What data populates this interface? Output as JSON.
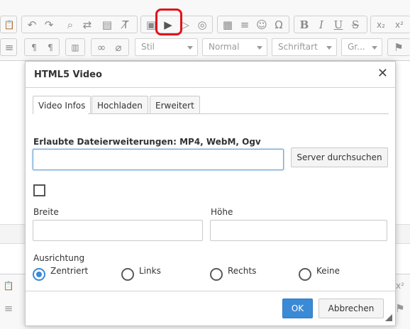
{
  "toolbar": {
    "row1": [
      {
        "icon": "undo-icon",
        "glyph": "↶"
      },
      {
        "icon": "redo-icon",
        "glyph": "↷"
      },
      {
        "icon": "find-icon",
        "glyph": "⌕"
      },
      {
        "icon": "replace-icon",
        "glyph": "⇄"
      },
      {
        "icon": "select-all-icon",
        "glyph": "▤"
      },
      {
        "icon": "remove-format-icon",
        "glyph": "T̸"
      },
      {
        "icon": "image-icon",
        "glyph": "▣"
      },
      {
        "icon": "html5-video-icon",
        "glyph": "▶"
      },
      {
        "icon": "audio-icon",
        "glyph": "▷"
      },
      {
        "icon": "flash-icon",
        "glyph": "◎"
      },
      {
        "icon": "table-icon",
        "glyph": "▦"
      },
      {
        "icon": "horizontal-line-icon",
        "glyph": "≡"
      },
      {
        "icon": "smiley-icon",
        "glyph": "☺"
      },
      {
        "icon": "special-char-icon",
        "glyph": "Ω"
      },
      {
        "icon": "bold-icon",
        "glyph": "B"
      },
      {
        "icon": "italic-icon",
        "glyph": "I"
      },
      {
        "icon": "underline-icon",
        "glyph": "U"
      },
      {
        "icon": "strike-icon",
        "glyph": "S"
      },
      {
        "icon": "subscript-icon",
        "glyph": "x₂"
      },
      {
        "icon": "superscript-icon",
        "glyph": "x²"
      }
    ],
    "combos": {
      "style": "Stil",
      "format": "Normal",
      "font": "Schriftart",
      "size": "Gr..."
    },
    "row2_icons": {
      "list": "≡",
      "ltr": "¶",
      "rtl": "¶",
      "templates": "▥",
      "link": "∞",
      "unlink": "⌀",
      "flag": "⚑"
    }
  },
  "dialog": {
    "title": "HTML5 Video",
    "close_glyph": "✕",
    "tabs": [
      "Video Infos",
      "Hochladen",
      "Erweitert"
    ],
    "allowed_extensions_label": "Erlaubte Dateierweiterungen: MP4, WebM, Ogv",
    "url_value": "",
    "browse_button": "Server durchsuchen",
    "width_label": "Breite",
    "height_label": "Höhe",
    "width_value": "",
    "height_value": "",
    "alignment_label": "Ausrichtung",
    "alignment_options": [
      "Zentriert",
      "Links",
      "Rechts",
      "Keine"
    ],
    "alignment_selected": "Zentriert",
    "ok_button": "OK",
    "cancel_button": "Abbrechen"
  },
  "colors": {
    "highlight": "#e0141c",
    "primary": "#3a8ad6",
    "focus": "#6fa5d8"
  }
}
